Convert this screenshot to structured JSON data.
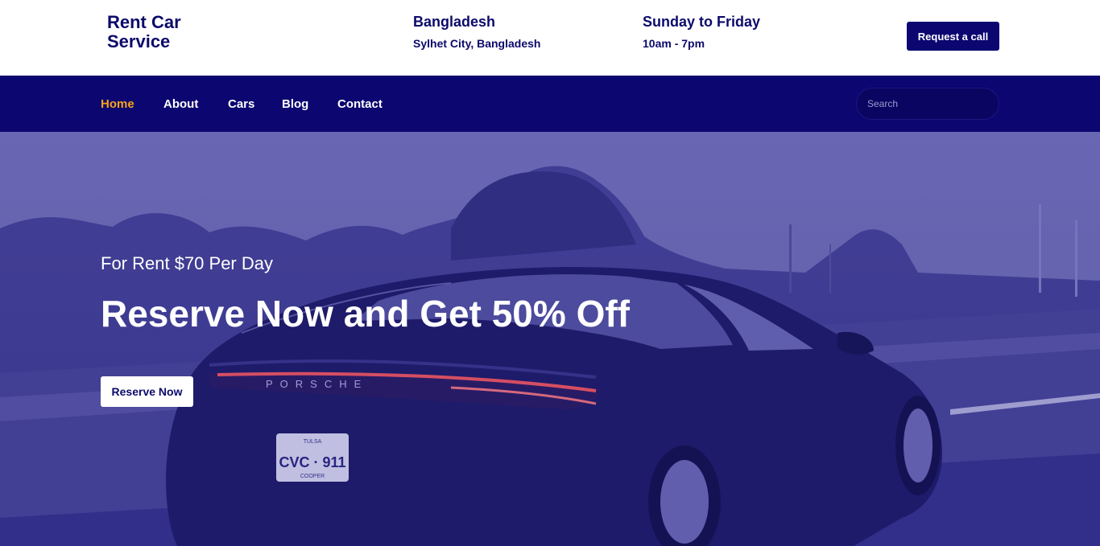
{
  "brand": {
    "name": "Rent Car Service"
  },
  "contact": {
    "location_title": "Bangladesh",
    "location_sub": "Sylhet City, Bangladesh",
    "hours_title": "Sunday to Friday",
    "hours_sub": "10am - 7pm",
    "request_label": "Request a call"
  },
  "nav": {
    "items": [
      {
        "label": "Home",
        "active": true
      },
      {
        "label": "About",
        "active": false
      },
      {
        "label": "Cars",
        "active": false
      },
      {
        "label": "Blog",
        "active": false
      },
      {
        "label": "Contact",
        "active": false
      }
    ],
    "search_placeholder": "Search"
  },
  "hero": {
    "subtitle": "For Rent $70 Per Day",
    "title": "Reserve Now and Get 50% Off",
    "button_label": "Reserve Now",
    "car_brand": "PORSCHE",
    "plate_text": "CVC · 911",
    "plate_top": "TULSA",
    "plate_bottom": "COOPER"
  },
  "colors": {
    "primary": "#0c0670",
    "brand_text": "#0c0a6b",
    "accent": "#f7a21b",
    "hero_tint": "#7674b6",
    "white": "#ffffff"
  }
}
